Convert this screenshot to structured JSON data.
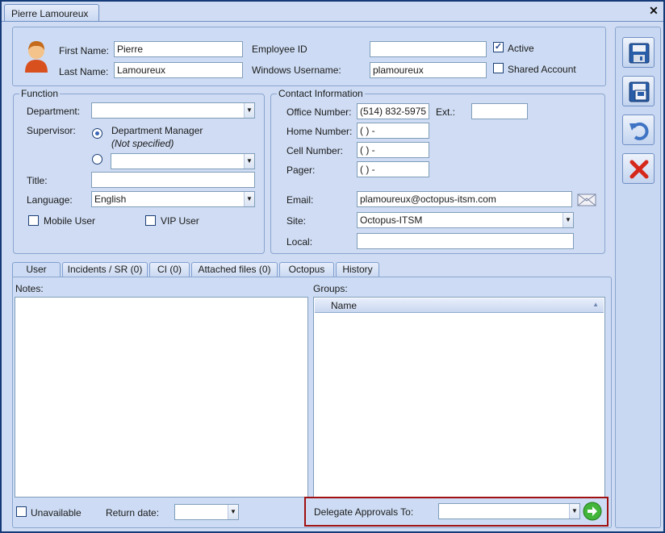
{
  "window": {
    "tab_title": "Pierre Lamoureux",
    "close_glyph": "✕"
  },
  "identity": {
    "first_name_label": "First Name:",
    "first_name_value": "Pierre",
    "last_name_label": "Last Name:",
    "last_name_value": "Lamoureux",
    "employee_id_label": "Employee ID",
    "employee_id_value": "",
    "windows_username_label": "Windows Username:",
    "windows_username_value": "plamoureux",
    "active_label": "Active",
    "active_checked": true,
    "shared_account_label": "Shared Account",
    "shared_account_checked": false,
    "avatar_icon": "user-avatar-icon"
  },
  "function": {
    "title": "Function",
    "department_label": "Department:",
    "department_value": "",
    "supervisor_label": "Supervisor:",
    "supervisor_option1": "Department Manager",
    "supervisor_option1_note": "(Not specified)",
    "supervisor_option2_value": "",
    "title_label": "Title:",
    "title_value": "",
    "language_label": "Language:",
    "language_value": "English",
    "mobile_user_label": "Mobile User",
    "vip_user_label": "VIP User"
  },
  "contact": {
    "title": "Contact Information",
    "office_label": "Office Number:",
    "office_value": "(514) 832-5975",
    "ext_label": "Ext.:",
    "ext_value": "",
    "home_label": "Home Number:",
    "home_value": "(  )   -",
    "cell_label": "Cell Number:",
    "cell_value": "(  )   -",
    "pager_label": "Pager:",
    "pager_value": "(  )   -",
    "email_label": "Email:",
    "email_value": "plamoureux@octopus-itsm.com",
    "site_label": "Site:",
    "site_value": "Octopus-ITSM",
    "local_label": "Local:",
    "local_value": ""
  },
  "tabs": [
    {
      "label": "User"
    },
    {
      "label": "Incidents / SR (0)"
    },
    {
      "label": "CI (0)"
    },
    {
      "label": "Attached files (0)"
    },
    {
      "label": "Octopus"
    },
    {
      "label": "History"
    }
  ],
  "user_tab": {
    "notes_label": "Notes:",
    "groups_label": "Groups:",
    "groups_column": "Name",
    "unavailable_label": "Unavailable",
    "return_date_label": "Return date:",
    "return_date_value": "",
    "delegate_label": "Delegate Approvals To:",
    "delegate_value": ""
  },
  "toolbar": {
    "save_icon": "save-icon",
    "save_close_icon": "save-close-icon",
    "undo_icon": "undo-icon",
    "delete_icon": "delete-icon"
  },
  "colors": {
    "background": "#cfdcf3",
    "border": "#8aa5cf",
    "highlight": "#a01010"
  }
}
